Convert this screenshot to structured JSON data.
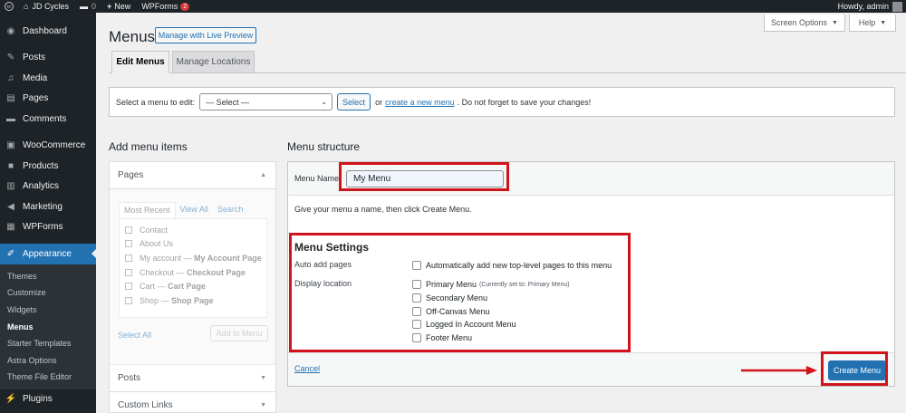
{
  "adminbar": {
    "site_name": "JD Cycles",
    "comments_count": "0",
    "new_label": "New",
    "wpforms_label": "WPForms",
    "wpforms_badge": "2",
    "greeting": "Howdy, admin"
  },
  "sidebar": {
    "group1": [
      {
        "label": "Dashboard",
        "icon": "dashboard-icon"
      }
    ],
    "group2": [
      {
        "label": "Posts",
        "icon": "pin-icon"
      },
      {
        "label": "Media",
        "icon": "media-icon"
      },
      {
        "label": "Pages",
        "icon": "page-icon"
      },
      {
        "label": "Comments",
        "icon": "comment-icon"
      }
    ],
    "group3": [
      {
        "label": "WooCommerce",
        "icon": "woocommerce-icon"
      },
      {
        "label": "Products",
        "icon": "archive-icon"
      },
      {
        "label": "Analytics",
        "icon": "chart-icon"
      },
      {
        "label": "Marketing",
        "icon": "megaphone-icon"
      },
      {
        "label": "WPForms",
        "icon": "forms-icon"
      }
    ],
    "appearance": "Appearance",
    "submenu": [
      "Themes",
      "Customize",
      "Widgets",
      "Menus",
      "Starter Templates",
      "Astra Options",
      "Theme File Editor"
    ],
    "current_sub": "Menus",
    "plugins": "Plugins"
  },
  "header": {
    "screen_options": "Screen Options",
    "help": "Help",
    "title": "Menus",
    "live_preview": "Manage with Live Preview"
  },
  "tabs": {
    "edit": "Edit Menus",
    "locations": "Manage Locations"
  },
  "manage": {
    "label": "Select a menu to edit:",
    "select_value": "— Select —",
    "select_button": "Select",
    "or": "or",
    "create_link": "create a new menu",
    "reminder": ". Do not forget to save your changes!"
  },
  "add_items": {
    "title": "Add menu items",
    "pages_label": "Pages",
    "inner_tabs": [
      "Most Recent",
      "View All",
      "Search"
    ],
    "pages": [
      {
        "name": "Contact",
        "suffix": ""
      },
      {
        "name": "About Us",
        "suffix": ""
      },
      {
        "name": "My account — ",
        "suffix": "My Account Page"
      },
      {
        "name": "Checkout — ",
        "suffix": "Checkout Page"
      },
      {
        "name": "Cart — ",
        "suffix": "Cart Page"
      },
      {
        "name": "Shop — ",
        "suffix": "Shop Page"
      }
    ],
    "select_all": "Select All",
    "add_button": "Add to Menu",
    "posts_label": "Posts",
    "custom_links_label": "Custom Links"
  },
  "structure": {
    "title": "Menu structure",
    "name_label": "Menu Name",
    "name_value": "My Menu",
    "instructions": "Give your menu a name, then click Create Menu.",
    "settings_title": "Menu Settings",
    "auto_add_label": "Auto add pages",
    "auto_add_option": "Automatically add new top-level pages to this menu",
    "display_label": "Display location",
    "locations": [
      {
        "label": "Primary Menu",
        "note": "(Currently set to: Primary Menu)"
      },
      {
        "label": "Secondary Menu",
        "note": ""
      },
      {
        "label": "Off-Canvas Menu",
        "note": ""
      },
      {
        "label": "Logged In Account Menu",
        "note": ""
      },
      {
        "label": "Footer Menu",
        "note": ""
      }
    ],
    "cancel": "Cancel",
    "create_button": "Create Menu"
  },
  "colors": {
    "admin_dark": "#1d2327",
    "accent": "#2271b1",
    "annotation_red": "#d0141b"
  }
}
